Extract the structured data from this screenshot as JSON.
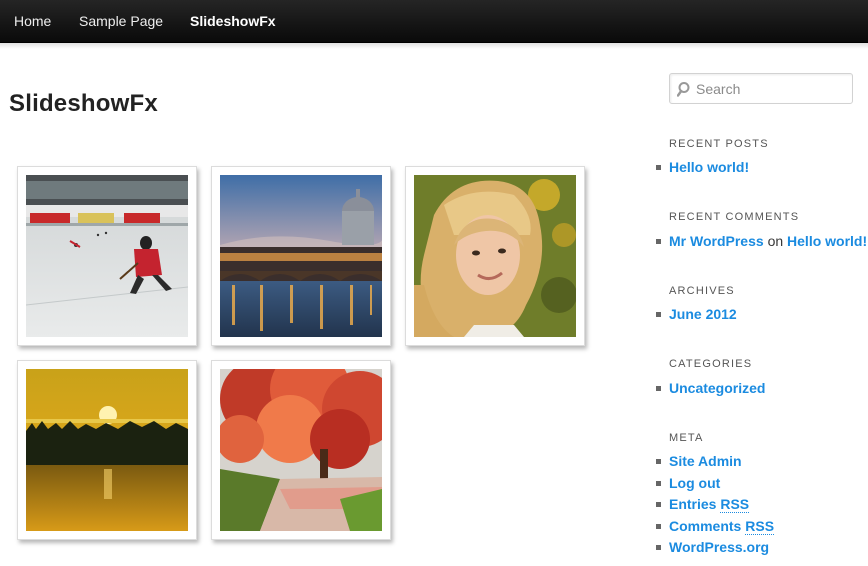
{
  "nav": {
    "items": [
      {
        "label": "Home"
      },
      {
        "label": "Sample Page"
      },
      {
        "label": "SlideshowFx",
        "current": true
      }
    ]
  },
  "page": {
    "title": "SlideshowFx"
  },
  "gallery": {
    "images": [
      {
        "subject": "ice hockey player on rink"
      },
      {
        "subject": "Rome river view with St. Peter's dome at dusk"
      },
      {
        "subject": "portrait of blonde girl"
      },
      {
        "subject": "golden sunset over lake and trees"
      },
      {
        "subject": "red autumn tree over path"
      }
    ]
  },
  "sidebar": {
    "search": {
      "placeholder": "Search"
    },
    "recent_posts": {
      "title": "RECENT POSTS",
      "items": [
        "Hello world!"
      ]
    },
    "recent_comments": {
      "title": "RECENT COMMENTS",
      "author": "Mr WordPress",
      "connector": "on",
      "post": "Hello world!"
    },
    "archives": {
      "title": "ARCHIVES",
      "items": [
        "June 2012"
      ]
    },
    "categories": {
      "title": "CATEGORIES",
      "items": [
        "Uncategorized"
      ]
    },
    "meta": {
      "title": "META",
      "site_admin": "Site Admin",
      "log_out": "Log out",
      "entries_prefix": "Entries",
      "entries_rss": "RSS",
      "comments_prefix": "Comments",
      "comments_rss": "RSS",
      "wordpress_org": "WordPress.org"
    }
  },
  "colors": {
    "link": "#1b8be0",
    "nav_bg": "#111111",
    "text": "#373737"
  }
}
